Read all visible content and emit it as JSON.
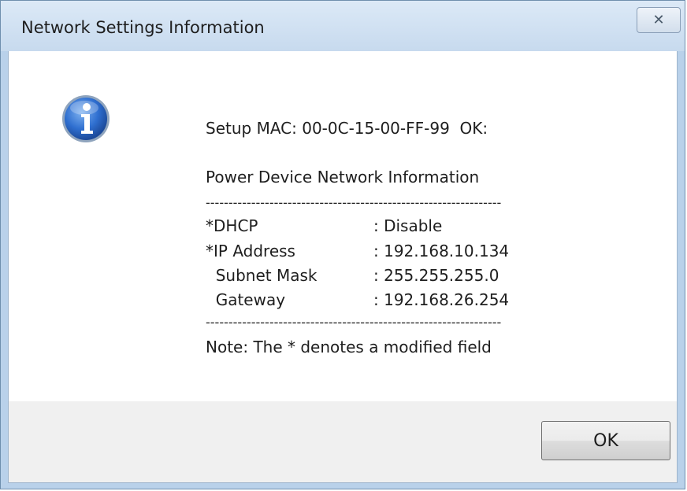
{
  "window": {
    "title": "Network Settings Information",
    "close_glyph": "✕"
  },
  "message": {
    "icon": "info-icon",
    "setup_line": "Setup MAC: 00-0C-15-00-FF-99  OK:",
    "section_title": "Power Device Network Information",
    "separator": "-----------------------------------------------------------------",
    "rows": [
      {
        "label": "*DHCP",
        "value": ": Disable"
      },
      {
        "label": "*IP Address",
        "value": ": 192.168.10.134"
      },
      {
        "label": "  Subnet Mask",
        "value": ": 255.255.255.0"
      },
      {
        "label": "  Gateway",
        "value": ": 192.168.26.254"
      }
    ],
    "note": "Note: The * denotes a modified field"
  },
  "buttons": {
    "ok_label": "OK"
  },
  "colors": {
    "icon_blue": "#2f6fd0",
    "titlebar": "#c7daee"
  }
}
